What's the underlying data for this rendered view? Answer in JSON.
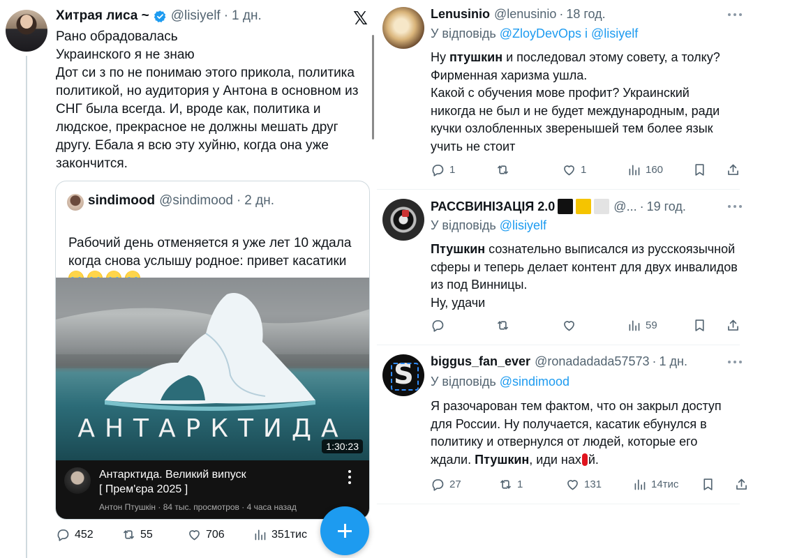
{
  "main_tweet": {
    "author_name": "Хитрая лиса ~",
    "author_handle": "@lisiyelf",
    "dot": "·",
    "time": "1 дн.",
    "text": "Рано обрадовалась\nУкраинского я не знаю\nДот си з по не понимаю этого прикола, политика политикой, но аудитория у Антона в основном из СНГ была всегда. И, вроде как, политика и людское, прекрасное не должны мешать друг другу. Ебала я всю эту хуйню, когда она уже закончится.",
    "x_logo": "𝕏",
    "quote": {
      "author_name": "sindimood",
      "author_handle": "@sindimood",
      "time": "2 дн.",
      "text": "Рабочий день отменяется я уже лет 10 ждала когда снова услышу родное: привет касатики",
      "emoji_count": 4,
      "video": {
        "overlay_title": "АНТАРКТИДА",
        "duration": "1:30:23",
        "title": "Антарктида. Великий випуск\n[ Прем'єра 2025 ]",
        "meta": "Антон Птушкін · 84 тыс. просмотров · 4 часа назад"
      }
    },
    "stats": {
      "replies": "452",
      "retweets": "55",
      "likes": "706",
      "views": "351тис"
    }
  },
  "replies": [
    {
      "author_name": "Lenusinio",
      "author_handle": "@lenusinio",
      "time": "18 год.",
      "replying_prefix": "У відповідь",
      "mentions": "@ZloyDevOps і @lisiyelf",
      "text_parts": [
        "Ну ",
        "птушкин",
        " и последовал этому совету, а толку? Фирменная харизма ушла.\nКакой с обучения мове профит? Украинский никогда не был и не будет международным, ради кучки озлобленных зверенышей тем более язык учить не стоит"
      ],
      "stats": {
        "replies": "1",
        "retweets": "",
        "likes": "1",
        "views": "160"
      }
    },
    {
      "author_name": "РАССВИНІЗАЦІЯ 2.0",
      "author_handle": "@...",
      "time": "19 год.",
      "replying_prefix": "У відповідь",
      "mentions": "@lisiyelf",
      "text_parts": [
        "Птушкин",
        " сознательно выписался из русскоязычной сферы и теперь делает контент для двух инвалидов из под Винницы.\nНу, удачи"
      ],
      "stats": {
        "replies": "",
        "retweets": "",
        "likes": "",
        "views": "59"
      }
    },
    {
      "author_name": "biggus_fan_ever",
      "author_handle": "@ronadadada57573",
      "time": "1 дн.",
      "replying_prefix": "У відповідь",
      "mentions": "@sindimood",
      "text_parts": [
        "Я разочарован тем фактом, что он закрыл доступ для России. Ну получается, касатик ебунулся в политику и отвернулся от людей, которые его ждали. ",
        "Птушкин",
        ", иди нах",
        "й."
      ],
      "stats": {
        "replies": "27",
        "retweets": "1",
        "likes": "131",
        "views": "14тис"
      }
    }
  ],
  "colors": {
    "accent": "#1d9bf0",
    "text": "#0f1419",
    "muted": "#536471",
    "border": "#cfd9de"
  },
  "icons": [
    "verified-badge-icon",
    "x-logo-icon",
    "reply-icon",
    "retweet-icon",
    "like-icon",
    "views-icon",
    "bookmark-icon",
    "share-icon",
    "more-icon",
    "compose-plus-icon"
  ]
}
